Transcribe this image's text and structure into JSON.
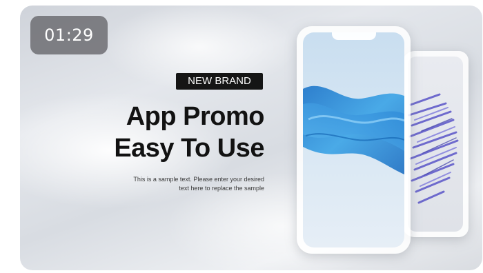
{
  "video_player": {
    "timestamp": "01:29"
  },
  "promo": {
    "badge": "NEW BRAND",
    "headline_line1": "App Promo",
    "headline_line2": "Easy To Use",
    "description_line1": "This is a sample text. Please enter your desired",
    "description_line2": "text here to replace the sample"
  },
  "colors": {
    "badge_background": "#151515",
    "headline": "#121212",
    "timer_background": "#69696e",
    "wave_blue": "#2f8fd8",
    "brush_purple": "#5a55c8"
  },
  "icons": {
    "front_phone_art": "blue-wave-graphic",
    "back_phone_art": "purple-brush-graphic"
  }
}
